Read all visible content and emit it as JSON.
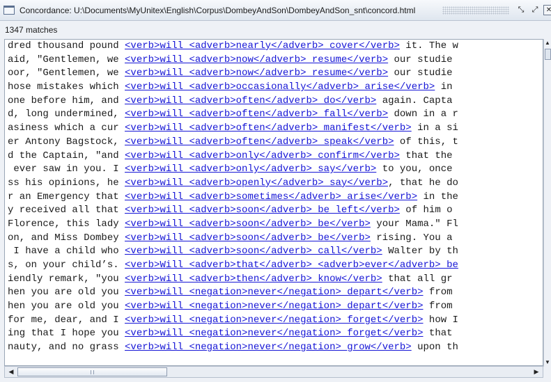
{
  "window": {
    "title": "Concordance: U:\\Documents\\MyUnitex\\English\\Corpus\\DombeyAndSon\\DombeyAndSon_snt\\concord.html",
    "icon": "internal-frame-icon",
    "buttons": {
      "minimize": "⤡",
      "maximize": "⤢",
      "close": "✕"
    }
  },
  "status": {
    "match_count": "1347 matches"
  },
  "concordance": {
    "lines": [
      {
        "left": "dred thousand pound ",
        "match": "<verb>will <adverb>nearly</adverb> cover</verb>",
        "right": " it. The w"
      },
      {
        "left": "aid, \"Gentlemen, we ",
        "match": "<verb>will <adverb>now</adverb> resume</verb>",
        "right": " our studie"
      },
      {
        "left": "oor, \"Gentlemen, we ",
        "match": "<verb>will <adverb>now</adverb> resume</verb>",
        "right": " our studie"
      },
      {
        "left": "hose mistakes which ",
        "match": "<verb>will <adverb>occasionally</adverb> arise</verb>",
        "right": " in"
      },
      {
        "left": "one before him, and ",
        "match": "<verb>will <adverb>often</adverb> do</verb>",
        "right": " again. Capta"
      },
      {
        "left": "d, long undermined, ",
        "match": "<verb>will <adverb>often</adverb> fall</verb>",
        "right": " down in a r"
      },
      {
        "left": "asiness which a cur ",
        "match": "<verb>will <adverb>often</adverb> manifest</verb>",
        "right": " in a si"
      },
      {
        "left": "er Antony Bagstock, ",
        "match": "<verb>will <adverb>often</adverb> speak</verb>",
        "right": " of this, t"
      },
      {
        "left": "d the Captain, \"and ",
        "match": "<verb>will <adverb>only</adverb> confirm</verb>",
        "right": " that the"
      },
      {
        "left": " ever saw in you. I ",
        "match": "<verb>will <adverb>only</adverb> say</verb>",
        "right": " to you, once"
      },
      {
        "left": "ss his opinions, he ",
        "match": "<verb>will <adverb>openly</adverb> say</verb>",
        "right": ", that he do"
      },
      {
        "left": "r an Emergency that ",
        "match": "<verb>will <adverb>sometimes</adverb> arise</verb>",
        "right": " in the"
      },
      {
        "left": "y received all that ",
        "match": "<verb>will <adverb>soon</adverb> be left</verb>",
        "right": " of him o"
      },
      {
        "left": "Florence, this lady ",
        "match": "<verb>will <adverb>soon</adverb> be</verb>",
        "right": " your Mama.\" Fl"
      },
      {
        "left": "on, and Miss Dombey ",
        "match": "<verb>will <adverb>soon</adverb> be</verb>",
        "right": " rising. You a"
      },
      {
        "left": " I have a child who ",
        "match": "<verb>will <adverb>soon</adverb> call</verb>",
        "right": " Walter by th"
      },
      {
        "left": "s, on your child’s. ",
        "match": "<verb>Will <adverb>that</adverb> <adverb>ever</adverb> be",
        "right": ""
      },
      {
        "left": "iendly remark, \"you ",
        "match": "<verb>will <adverb>then</adverb> know</verb>",
        "right": " that all gr"
      },
      {
        "left": "hen you are old you ",
        "match": "<verb>will <negation>never</negation> depart</verb>",
        "right": " from"
      },
      {
        "left": "hen you are old you ",
        "match": "<verb>will <negation>never</negation> depart</verb>",
        "right": " from"
      },
      {
        "left": "for me, dear, and I ",
        "match": "<verb>will <negation>never</negation> forget</verb>",
        "right": " how I"
      },
      {
        "left": "ing that I hope you ",
        "match": "<verb>will <negation>never</negation> forget</verb>",
        "right": " that"
      },
      {
        "left": "nauty, and no grass ",
        "match": "<verb>will <negation>never</negation> grow</verb>",
        "right": " upon th"
      }
    ]
  },
  "scrollbars": {
    "vertical": {
      "up": "▲",
      "down": "▼"
    },
    "horizontal": {
      "left": "◀",
      "right": "▶"
    }
  }
}
